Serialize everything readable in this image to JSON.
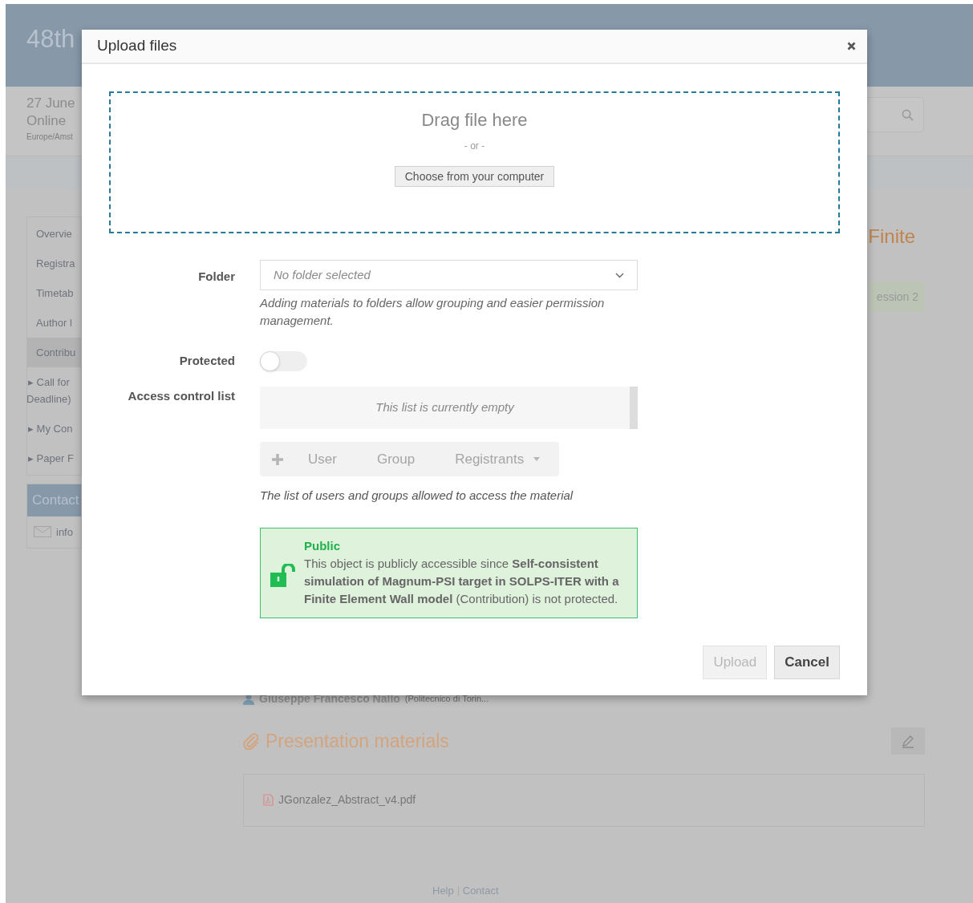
{
  "page": {
    "title": "48th",
    "date": "27 June",
    "location": "Online",
    "timezone": "Europe/Amst",
    "sidebar": [
      {
        "kind": "link",
        "lines": [
          "Overvie"
        ],
        "selected": false
      },
      {
        "kind": "link",
        "lines": [
          "Registra"
        ],
        "selected": false
      },
      {
        "kind": "link",
        "lines": [
          "Timetab"
        ],
        "selected": false
      },
      {
        "kind": "link",
        "lines": [
          "Author l"
        ],
        "selected": false
      },
      {
        "kind": "link",
        "lines": [
          "Contribu"
        ],
        "selected": true
      },
      {
        "kind": "expandable",
        "marker": "▸",
        "lines": [
          "Call for",
          "Deadline)"
        ],
        "selected": false
      },
      {
        "kind": "expandable",
        "marker": "▸",
        "lines": [
          "My Con"
        ],
        "selected": false
      },
      {
        "kind": "expandable",
        "marker": "▸",
        "lines": [
          "Paper F"
        ],
        "selected": false
      }
    ],
    "contact": {
      "title": "Contact",
      "email": "info"
    },
    "heading_fragment": "Finite",
    "session_badge": "ession 2",
    "author": {
      "name": "Giuseppe Francesco Nallo",
      "affiliation": "(Politecnico di Torin..."
    },
    "materials": {
      "title": "Presentation materials",
      "files": [
        "JGonzalez_Abstract_v4.pdf"
      ]
    },
    "footer_links": [
      "Help",
      "Contact"
    ]
  },
  "dialog": {
    "title": "Upload files",
    "dropzone": {
      "heading": "Drag file here",
      "separator": "- or -",
      "button": "Choose from your computer"
    },
    "fields": [
      {
        "kind": "select",
        "label": "Folder",
        "placeholder": "No folder selected",
        "help": "Adding materials to folders allow grouping and easier permission management."
      },
      {
        "kind": "toggle",
        "label": "Protected",
        "on": false
      },
      {
        "kind": "acl",
        "label": "Access control list",
        "empty_text": "This list is currently empty",
        "buttons": [
          {
            "kind": "add"
          },
          {
            "kind": "text",
            "label": "User"
          },
          {
            "kind": "text",
            "label": "Group"
          },
          {
            "kind": "dropdown",
            "label": "Registrants"
          }
        ],
        "help": "The list of users and groups allowed to access the material"
      }
    ],
    "notice": {
      "title": "Public",
      "text": "This object is publicly accessible since **Self-consistent simulation of Magnum-PSI target in SOLPS-ITER with a Finite Element Wall model** (Contribution) is not protected."
    },
    "buttons": [
      {
        "label": "Upload",
        "disabled": true
      },
      {
        "label": "Cancel",
        "disabled": false
      }
    ]
  }
}
